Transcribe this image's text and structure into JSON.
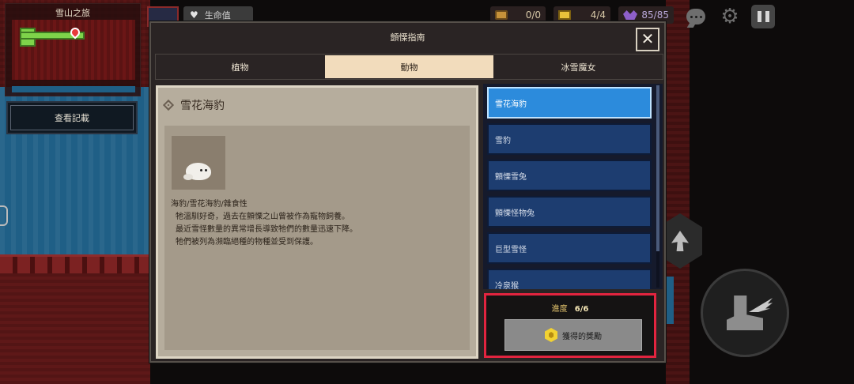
{
  "minimap": {
    "title": "雪山之旅"
  },
  "record_button": {
    "label": "查看記載"
  },
  "top_bar": {
    "life_label": "生命值",
    "chest_count": "0/0",
    "gem_count": "4/4",
    "bat_count": "85/85"
  },
  "modal": {
    "title": "顫慄指南",
    "close_glyph": "✕",
    "tabs": [
      {
        "label": "植物",
        "active": false
      },
      {
        "label": "動物",
        "active": true
      },
      {
        "label": "冰雪魔女",
        "active": false
      }
    ],
    "detail": {
      "name": "雪花海豹",
      "tags": "海豹/雪花海豹/雜食性",
      "description": [
        "牠溫馴好奇，過去在顫慄之山曾被作為寵物飼養。",
        "最近雪怪數量的異常增長導致牠們的數量迅速下降。",
        "牠們被列為瀕臨絕種的物種並受到保護。"
      ]
    },
    "list": {
      "items": [
        "雪花海豹",
        "雪豹",
        "顫慄雪兔",
        "顫慄怪物兔",
        "巨型雪怪",
        "冷泉猴"
      ],
      "selected_index": 0
    },
    "progress": {
      "label": "進度",
      "value": "6/6"
    },
    "reward_button": {
      "label": "獲得的獎勵"
    }
  },
  "icons": {
    "life": "heart-icon",
    "chest": "chest-icon",
    "gem": "gem-icon",
    "bat": "bat-icon",
    "chat": "chat-icon",
    "settings": "gear-icon",
    "pause": "pause-icon",
    "close": "close-icon",
    "skill": "skill-icon",
    "dash": "boot-icon",
    "detail": "diamond-icon"
  },
  "colors": {
    "highlight_border": "#e2243f",
    "selected_item": "#2c8bdc",
    "active_tab": "#f2dcbc",
    "list_item": "#1d3d70"
  }
}
